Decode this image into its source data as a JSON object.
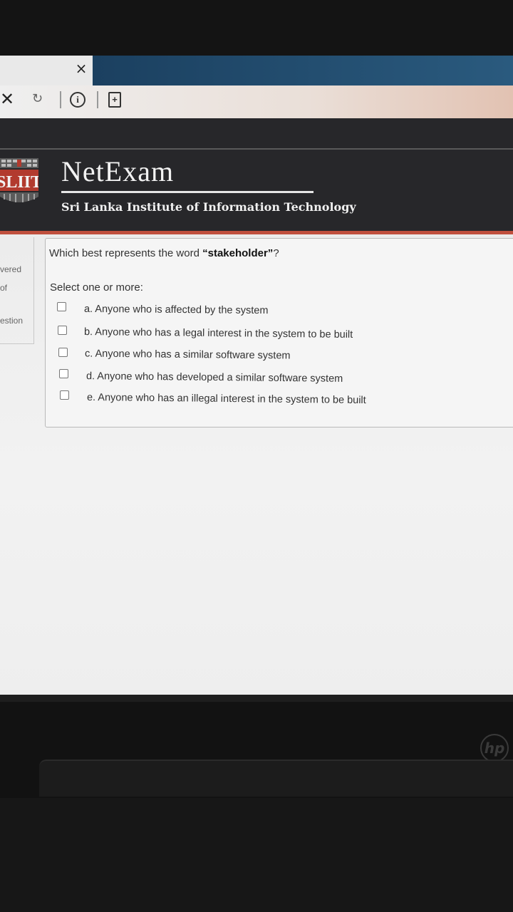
{
  "browser": {
    "tab_close_glyph": "×",
    "stop_glyph": "✕",
    "reload_glyph": "↻",
    "info_glyph": "i",
    "page_glyph": "+"
  },
  "header": {
    "logo_text": "SLIIT",
    "brand": "NetExam",
    "subtitle": "Sri Lanka Institute of Information Technology"
  },
  "sidebar": {
    "line1": "vered",
    "line2": "of",
    "line3": "estion"
  },
  "question": {
    "text_before": "Which best represents the word ",
    "text_bold": "“stakeholder”",
    "text_after": "?",
    "prompt": "Select one or more:",
    "options": [
      {
        "label": "a. Anyone who is affected by the system",
        "checked": false
      },
      {
        "label": "b. Anyone who has a legal interest in the system to be built",
        "checked": false
      },
      {
        "label": "c. Anyone who has a similar software system",
        "checked": false
      },
      {
        "label": "d. Anyone who has developed a similar software system",
        "checked": false
      },
      {
        "label": "e. Anyone who has an illegal interest in the system to be built",
        "checked": false
      }
    ]
  },
  "device": {
    "brand_logo": "hp"
  },
  "colors": {
    "header_bg": "#27272a",
    "header_accent": "#c0503e",
    "tab_active": "#1b4060"
  }
}
